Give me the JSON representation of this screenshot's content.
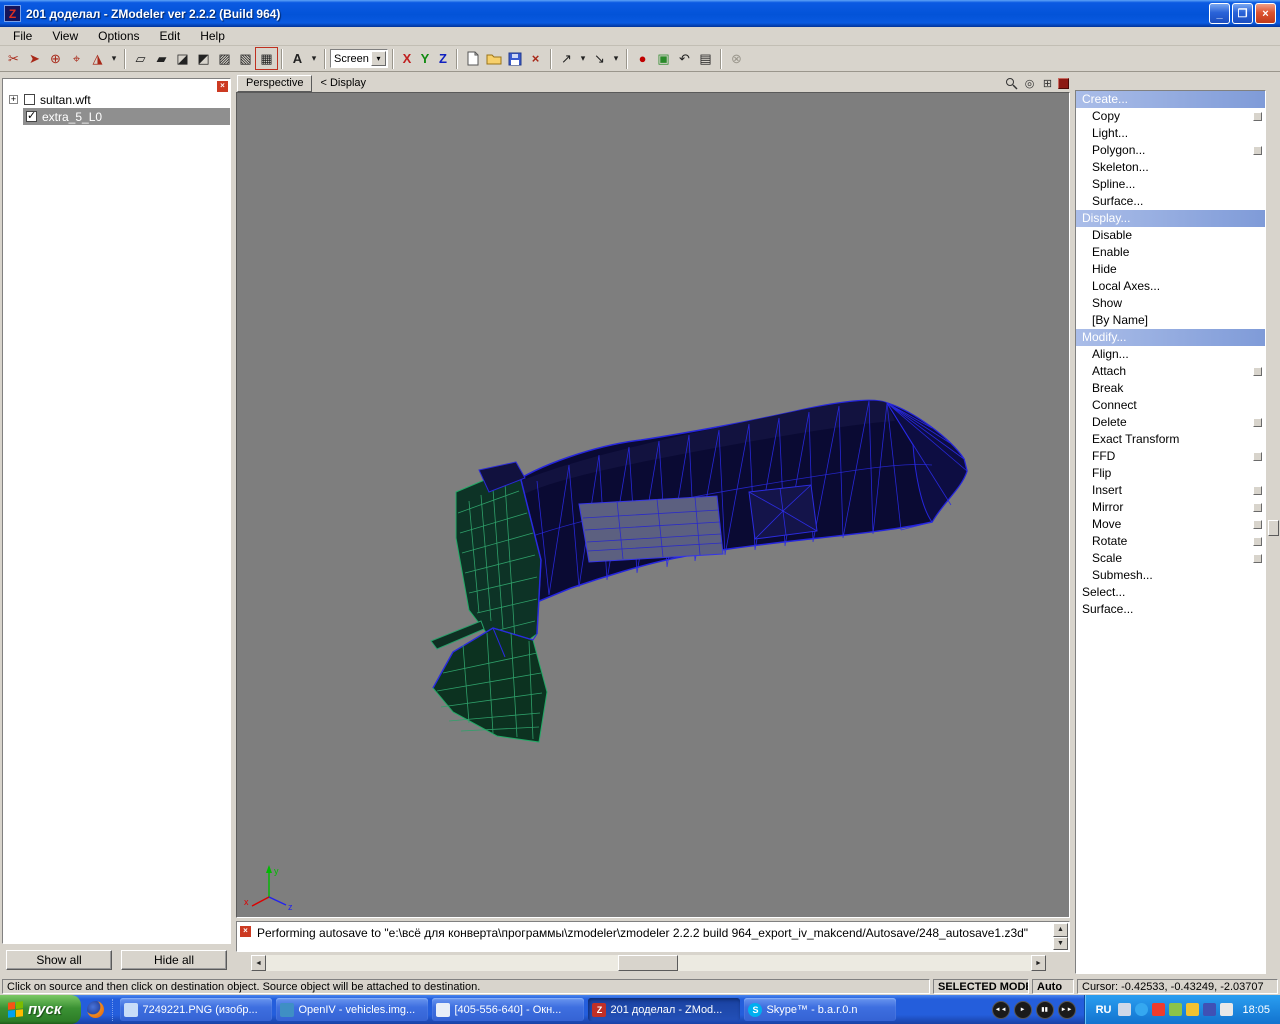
{
  "window": {
    "title": "201 доделал - ZModeler ver 2.2.2 (Build 964)",
    "icon_letter": "Z",
    "controls": {
      "minimize": "_",
      "maximize": "❐",
      "close": "×"
    }
  },
  "menu_bar": {
    "items": [
      "File",
      "View",
      "Options",
      "Edit",
      "Help"
    ]
  },
  "toolbar": {
    "screen_value": "Screen",
    "text_tool": "A",
    "axis": {
      "x": "X",
      "y": "Y",
      "z": "Z"
    },
    "glyphs": {
      "cut": "✂",
      "pick": "➤",
      "add": "⊕",
      "target": "⌖",
      "prism": "◮",
      "drop": "▾",
      "mode1": "▱",
      "mode2": "▰",
      "mode3": "◪",
      "mode4": "◩",
      "mode5": "▨",
      "mode6": "▧",
      "mode7": "▦",
      "del": "×",
      "exp": "↗",
      "imp": "↘",
      "rec": "●",
      "pkg": "▣",
      "undo": "↶",
      "list": "▤",
      "link": "⊗",
      "pan": "◎",
      "fit": "⊞"
    }
  },
  "left_panel": {
    "expander": "+",
    "tree": [
      {
        "label": "sultan.wft"
      },
      {
        "label": "extra_5_L0"
      }
    ],
    "show_all": "Show all",
    "hide_all": "Hide all"
  },
  "viewport": {
    "perspective_label": "Perspective",
    "display_breadcrumb": "< Display",
    "gizmo": {
      "x": "x",
      "y": "y",
      "z": "z"
    }
  },
  "command_panel": {
    "sections": [
      {
        "header": "Create...",
        "items": [
          {
            "label": "Copy",
            "box": true
          },
          {
            "label": "Light..."
          },
          {
            "label": "Polygon...",
            "box": true
          },
          {
            "label": "Skeleton..."
          },
          {
            "label": "Spline..."
          },
          {
            "label": "Surface..."
          }
        ]
      },
      {
        "header": "Display...",
        "items": [
          {
            "label": "Disable"
          },
          {
            "label": "Enable"
          },
          {
            "label": "Hide"
          },
          {
            "label": "Local Axes..."
          },
          {
            "label": "Show"
          },
          {
            "label": "[By Name]"
          }
        ]
      },
      {
        "header": "Modify...",
        "items": [
          {
            "label": "Align..."
          },
          {
            "label": "Attach",
            "box": true
          },
          {
            "label": "Break"
          },
          {
            "label": "Connect"
          },
          {
            "label": "Delete",
            "box": true
          },
          {
            "label": "Exact Transform"
          },
          {
            "label": "FFD",
            "box": true
          },
          {
            "label": "Flip"
          },
          {
            "label": "Insert",
            "box": true
          },
          {
            "label": "Mirror",
            "box": true
          },
          {
            "label": "Move",
            "box": true
          },
          {
            "label": "Rotate",
            "box": true
          },
          {
            "label": "Scale",
            "box": true
          },
          {
            "label": "Submesh..."
          }
        ]
      },
      {
        "header": "Select...",
        "items": []
      },
      {
        "header": "Surface...",
        "items": []
      }
    ]
  },
  "log": {
    "message": "Performing autosave to \"e:\\всё для конверта\\программы\\zmodeler\\zmodeler 2.2.2 build 964_export_iv_makcend/Autosave/248_autosave1.z3d\""
  },
  "status_bar": {
    "hint": "Click on source and then click on destination object. Source object will be attached to destination.",
    "mode": "SELECTED MODE",
    "auto_label": "Auto",
    "cursor": "Cursor: -0.42533, -0.43249, -2.03707"
  },
  "taskbar": {
    "start_label": "пуск",
    "tasks": [
      {
        "label": "7249221.PNG (изобр...",
        "glyph": ""
      },
      {
        "label": "OpenIV - vehicles.img...",
        "glyph": ""
      },
      {
        "label": "[405-556-640] - Окн...",
        "glyph": ""
      },
      {
        "label": "201 доделал - ZMod...",
        "glyph": "Z"
      },
      {
        "label": "Skype™ - b.a.r.0.n",
        "glyph": "S"
      }
    ],
    "media": [
      "◄◄",
      "►",
      "▮▮",
      "►►"
    ],
    "language": "RU",
    "clock": "18:05"
  },
  "icons": {
    "close_x": "×",
    "up": "▲",
    "down": "▼",
    "left": "◄",
    "right": "►"
  }
}
